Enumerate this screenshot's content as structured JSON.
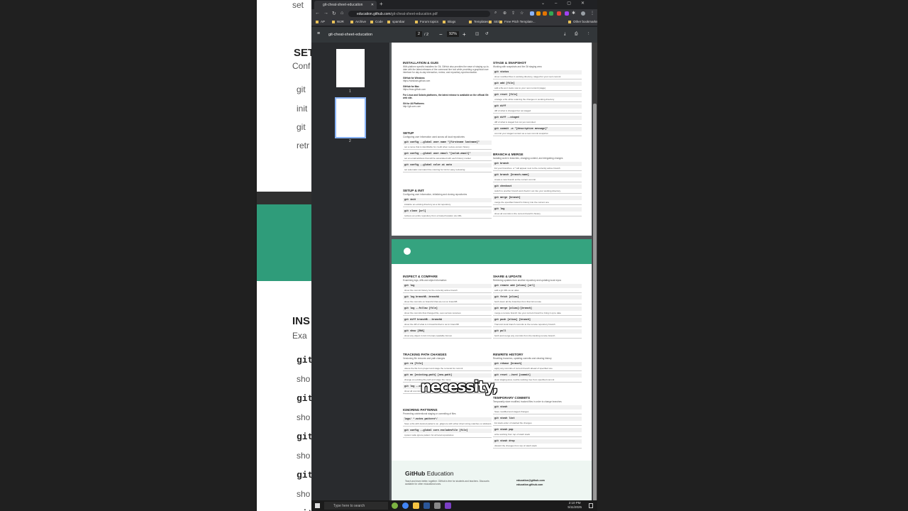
{
  "browser": {
    "tab_title": "git-cheat-sheet-education",
    "url_domain": "education.github.com",
    "url_path": "/git-cheat-sheet-education.pdf",
    "bookmarks": [
      "AP",
      "WJR",
      "Archive",
      "Code",
      "spambar",
      "Forum topics",
      "Blogs",
      "Templates",
      "SEO",
      "Free Pitch Template...",
      "Other bookmarks"
    ]
  },
  "pdf": {
    "title": "git-cheat-sheet-education",
    "page_current": "2",
    "page_total": "/  2",
    "zoom": "92%",
    "thumbs": [
      "1",
      "2"
    ]
  },
  "page1": {
    "left": [
      {
        "h": "INSTALLATION & GUIS",
        "d": "With platform specific installers for Git, GitHub also provides the ease of staying up-to-date with the latest releases of the command line tool while providing a graphical user interface for day-to-day interaction, review, and repository synchronization.",
        "items": [
          [
            "GitHub for Windows",
            "https://windows.github.com"
          ],
          [
            "GitHub for Mac",
            "https://mac.github.com"
          ],
          [
            "For Linux and Solaris platforms, the latest release is available on the official Git web site.",
            ""
          ],
          [
            "Git for All Platforms",
            "http://git-scm.com"
          ]
        ]
      },
      {
        "h": "SETUP",
        "d": "Configuring user information used across all local repositories",
        "cmds": [
          [
            "git config --global user.name \"[firstname lastname]\"",
            "set a name that is identifiable for credit when review version history"
          ],
          [
            "git config --global user.email \"[valid-email]\"",
            "set an email address that will be associated with each history marker"
          ],
          [
            "git config --global color.ui auto",
            "set automatic command line coloring for Git for easy reviewing"
          ]
        ]
      },
      {
        "h": "SETUP & INIT",
        "d": "Configuring user information, initializing and cloning repositories",
        "cmds": [
          [
            "git init",
            "initialize an existing directory as a Git repository"
          ],
          [
            "git clone [url]",
            "retrieve an entire repository from a hosted location via URL"
          ]
        ]
      }
    ],
    "right": [
      {
        "h": "STAGE & SNAPSHOT",
        "d": "Working with snapshots and the Git staging area",
        "cmds": [
          [
            "git status",
            "show modified files in working directory, staged for your next commit"
          ],
          [
            "git add [file]",
            "add a file as it looks now to your next commit (stage)"
          ],
          [
            "git reset [file]",
            "unstage a file while retaining the changes in working directory"
          ],
          [
            "git diff",
            "diff of what is changed but not staged"
          ],
          [
            "git diff --staged",
            "diff of what is staged but not yet commited"
          ],
          [
            "git commit -m \"[descriptive message]\"",
            "commit your staged content as a new commit snapshot"
          ]
        ]
      },
      {
        "h": "BRANCH & MERGE",
        "d": "Isolating work in branches, changing context, and integrating changes",
        "cmds": [
          [
            "git branch",
            "list your branches. a * will appear next to the currently active branch"
          ],
          [
            "git branch [branch-name]",
            "create a new branch at the current commit"
          ],
          [
            "git checkout",
            "switch to another branch and check it out into your working directory"
          ],
          [
            "git merge [branch]",
            "merge the specified branch's history into the current one"
          ],
          [
            "git log",
            "show all commits in the current branch's history"
          ]
        ]
      }
    ]
  },
  "page2": {
    "left": [
      {
        "h": "INSPECT & COMPARE",
        "d": "Examining logs, diffs and object information",
        "cmds": [
          [
            "git log",
            "show the commit history for the currently active branch"
          ],
          [
            "git log branchB..branchA",
            "show the commits on branchA that are not on branchB"
          ],
          [
            "git log --follow [file]",
            "show the commits that changed file, even across renames"
          ],
          [
            "git diff branchB...branchA",
            "show the diff of what is in branchA that is not in branchB"
          ],
          [
            "git show [SHA]",
            "show any object in Git in human-readable format"
          ]
        ]
      },
      {
        "h": "TRACKING PATH CHANGES",
        "d": "Versioning file removes and path changes",
        "cmds": [
          [
            "git rm [file]",
            "delete the file from project and stage the removal for commit"
          ],
          [
            "git mv [existing-path] [new-path]",
            "change an existing file path and stage the move"
          ],
          [
            "git log --stat -M",
            "show all commit logs with indication of any paths that moved"
          ]
        ]
      },
      {
        "h": "IGNORING PATTERNS",
        "d": "Preventing unintentional staging or commiting of files",
        "cmds": [
          [
            "logs/  *.notes  pattern*/",
            "Save a file with desired patterns as .gitignore with either direct string matches or wildcard globs."
          ],
          [
            "git config --global core.excludesfile [file]",
            "system wide ignore pattern for all local repositories"
          ]
        ]
      }
    ],
    "right": [
      {
        "h": "SHARE & UPDATE",
        "d": "Retrieving updates from another repository and updating local repos",
        "cmds": [
          [
            "git remote add [alias] [url]",
            "add a git URL as an alias"
          ],
          [
            "git fetch [alias]",
            "fetch down all the branches from that Git remote"
          ],
          [
            "git merge [alias]/[branch]",
            "merge a remote branch into your current branch to bring it up to date"
          ],
          [
            "git push [alias] [branch]",
            "Transmit local branch commits to the remote repository branch"
          ],
          [
            "git pull",
            "fetch and merge any commits from the tracking remote branch"
          ]
        ]
      },
      {
        "h": "REWRITE HISTORY",
        "d": "Rewriting branches, updating commits and clearing history",
        "cmds": [
          [
            "git rebase [branch]",
            "apply any commits of current branch ahead of specified one"
          ],
          [
            "git reset --hard [commit]",
            "clear staging area, rewrite working tree from specified commit"
          ]
        ]
      },
      {
        "h": "TEMPORARY COMMITS",
        "d": "Temporarily store modified, tracked files in order to change branches",
        "cmds": [
          [
            "git stash",
            "Save modified and staged changes"
          ],
          [
            "git stash list",
            "list stack-order of stashed file changes"
          ],
          [
            "git stash pop",
            "write working from top of stash stack"
          ],
          [
            "git stash drop",
            "discard the changes from top of stash stack"
          ]
        ]
      }
    ],
    "footer": {
      "brand": "GitHub",
      "brand2": "Education",
      "text": "Teach and learn better, together. GitHub is free for students and teachers. Discounts available for other educational uses.",
      "email": "education@github.com",
      "site": "education.github.com"
    }
  },
  "caption": "necessity,",
  "background": {
    "lines": [
      "branch [branch-name]",
      "checkout",
      "merge [branch]",
      "log"
    ],
    "descs": [
      "a new branch at the current commit",
      "ch to another branch and check it out into your working directory",
      "e the specified branch's history into the current one",
      "all commits in the current branch's history"
    ],
    "left_frag": [
      "set",
      "SET",
      "Conf",
      "git",
      "init",
      "git",
      "retr"
    ],
    "lower_lines": [
      "remote add [alias] [url]",
      "fetch [alias]",
      "merge [alias]/[branch]",
      "push [alias] [branch]",
      "pull"
    ],
    "lower_descs": [
      "a git URL as an alias",
      "h down all the branches from that Git remote",
      "ge a remote branch into your current branch to bring it up to date",
      "smit local branch commits to the remote repository branch"
    ],
    "lower_heads": [
      "INS",
      "Exa",
      "RE & UPDATE",
      "eving updates from another repository and updating local repos"
    ],
    "lower_left": [
      "git",
      "sho",
      "git",
      "sho",
      "git",
      "sho",
      "git",
      "sho",
      "git"
    ]
  },
  "taskbar": {
    "search": "Type here to search",
    "time": "2:10 PM",
    "date": "5/11/2025"
  }
}
